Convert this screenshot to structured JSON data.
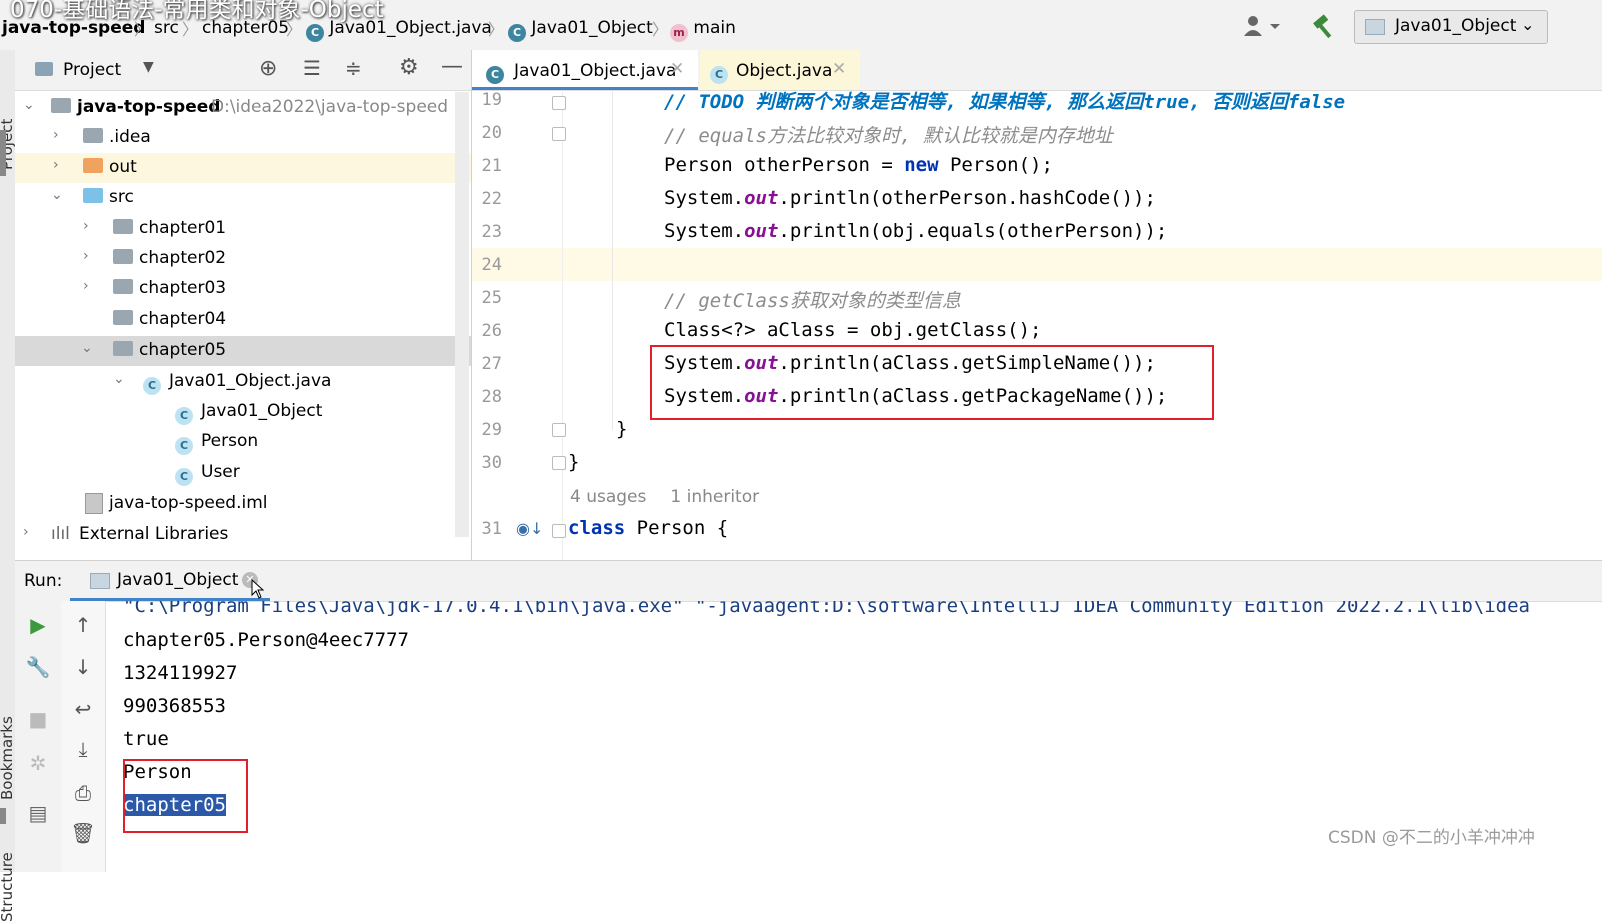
{
  "video_title": "070-基础语法-常用类和对象-Object",
  "breadcrumbs": [
    "java-top-speed",
    "src",
    "chapter05",
    "Java01_Object.java",
    "Java01_Object",
    "main"
  ],
  "run_config": {
    "label": "Java01_Object"
  },
  "icons": {
    "user": "user-icon",
    "build": "hammer-icon",
    "settings": "gear-icon"
  },
  "left_stripe": {
    "project": "Project",
    "bookmarks": "Bookmarks",
    "structure": "Structure"
  },
  "project_panel": {
    "title": "Project",
    "tree": [
      {
        "label": "java-top-speed",
        "path": "D:\\idea2022\\java-top-speed"
      },
      {
        "label": ".idea"
      },
      {
        "label": "out"
      },
      {
        "label": "src"
      },
      {
        "label": "chapter01"
      },
      {
        "label": "chapter02"
      },
      {
        "label": "chapter03"
      },
      {
        "label": "chapter04"
      },
      {
        "label": "chapter05"
      },
      {
        "label": "Java01_Object.java"
      },
      {
        "label": "Java01_Object"
      },
      {
        "label": "Person"
      },
      {
        "label": "User"
      },
      {
        "label": "java-top-speed.iml"
      },
      {
        "label": "External Libraries"
      }
    ]
  },
  "editor": {
    "tabs": [
      {
        "label": "Java01_Object.java",
        "active": true
      },
      {
        "label": "Object.java",
        "active": false
      }
    ],
    "line_numbers": [
      "19",
      "20",
      "21",
      "22",
      "23",
      "24",
      "25",
      "26",
      "27",
      "28",
      "29",
      "30",
      "31"
    ],
    "lines": {
      "l19": "// TODO 判断两个对象是否相等, 如果相等, 那么返回true, 否则返回false",
      "l20": "// equals方法比较对象时, 默认比较就是内存地址",
      "l21a": "Person otherPerson = ",
      "l21b": "new",
      "l21c": " Person();",
      "l22a": "System.",
      "l22b": "out",
      "l22c": ".println(otherPerson.hashCode());",
      "l23a": "System.",
      "l23b": "out",
      "l23c": ".println(obj.equals(otherPerson));",
      "l25": "// getClass获取对象的类型信息",
      "l26": "Class<?> aClass = obj.getClass();",
      "l27a": "System.",
      "l27b": "out",
      "l27c": ".println(aClass.getSimpleName());",
      "l28a": "System.",
      "l28b": "out",
      "l28c": ".println(aClass.getPackageName());",
      "l29": "}",
      "l30": "}",
      "usages": "4 usages",
      "inheritors": "1 inheritor",
      "l31a": "class",
      "l31b": " Person {"
    }
  },
  "run_panel": {
    "label": "Run:",
    "tab": "Java01_Object",
    "output": [
      "\"C:\\Program Files\\Java\\jdk-17.0.4.1\\bin\\java.exe\" \"-javaagent:D:\\software\\IntelliJ IDEA Community Edition 2022.2.1\\lib\\idea",
      "chapter05.Person@4eec7777",
      "1324119927",
      "990368553",
      "true",
      "Person",
      "chapter05"
    ]
  },
  "watermark": "CSDN @不二的小羊冲冲冲",
  "colors": {
    "highlight_box": "#e0202a",
    "selection": "#2b59a8",
    "keyword": "#0033b3",
    "field": "#871094"
  }
}
